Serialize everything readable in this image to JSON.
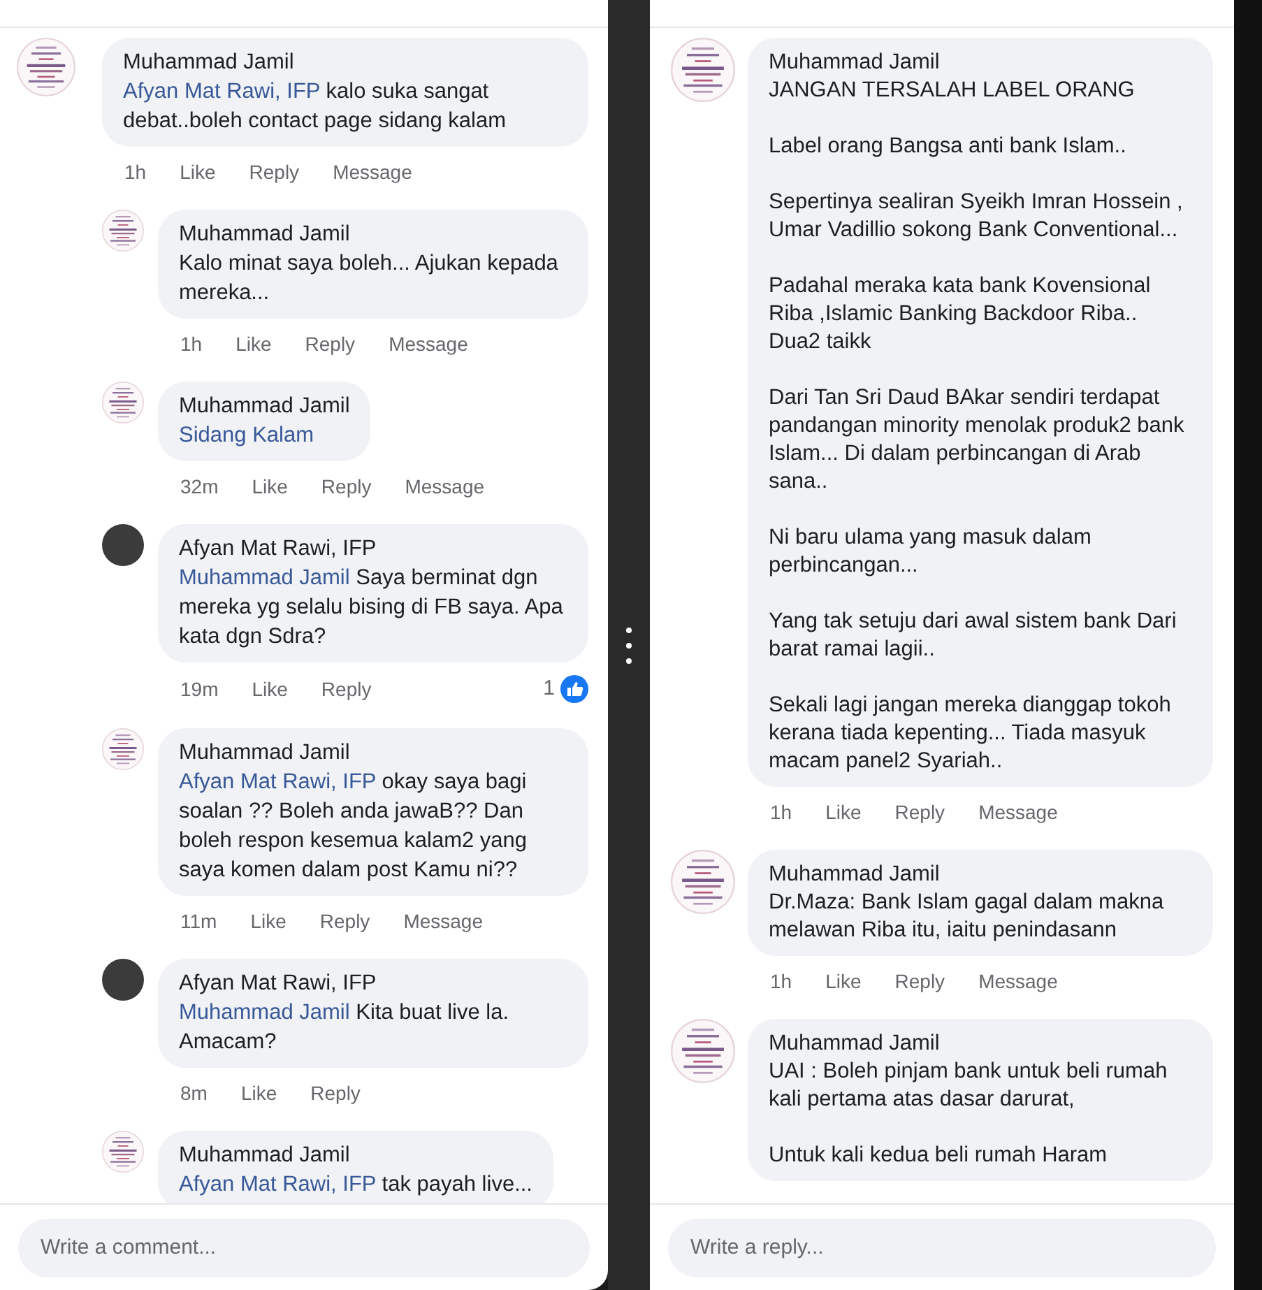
{
  "panels": [
    {
      "comments": [
        {
          "kind": "top",
          "avatar": {
            "kind": "logo"
          },
          "author": "Muhammad Jamil",
          "mention": "Afyan Mat Rawi, IFP",
          "text": "kalo suka sangat debat..boleh contact page sidang kalam",
          "time": "1h",
          "actions": [
            "Like",
            "Reply",
            "Message"
          ]
        },
        {
          "kind": "reply",
          "avatar": {
            "kind": "logo"
          },
          "author": "Muhammad Jamil",
          "text": "Kalo minat saya boleh... Ajukan kepada mereka...",
          "time": "1h",
          "actions": [
            "Like",
            "Reply",
            "Message"
          ]
        },
        {
          "kind": "reply",
          "avatar": {
            "kind": "logo"
          },
          "author": "Muhammad Jamil",
          "mention": "Sidang Kalam",
          "time": "32m",
          "actions": [
            "Like",
            "Reply",
            "Message"
          ]
        },
        {
          "kind": "reply",
          "avatar": {
            "kind": "photo"
          },
          "author": "Afyan Mat Rawi, IFP",
          "mention": "Muhammad Jamil",
          "text": "Saya berminat dgn mereka yg selalu bising di FB saya. Apa kata dgn Sdra?",
          "time": "19m",
          "actions": [
            "Like",
            "Reply"
          ],
          "reactions": "1"
        },
        {
          "kind": "reply",
          "avatar": {
            "kind": "logo"
          },
          "author": "Muhammad Jamil",
          "mention": "Afyan Mat Rawi, IFP",
          "text": "okay saya bagi soalan ?? Boleh anda jawaB?? Dan boleh respon kesemua kalam2 yang saya komen dalam post Kamu ni??",
          "time": "11m",
          "actions": [
            "Like",
            "Reply",
            "Message"
          ]
        },
        {
          "kind": "reply",
          "avatar": {
            "kind": "photo"
          },
          "author": "Afyan Mat Rawi, IFP",
          "mention": "Muhammad Jamil",
          "text": "Kita buat live la. Amacam?",
          "time": "8m",
          "actions": [
            "Like",
            "Reply"
          ]
        },
        {
          "kind": "reply",
          "avatar": {
            "kind": "logo"
          },
          "author": "Muhammad Jamil",
          "mention": "Afyan Mat Rawi, IFP",
          "text": "tak payah live..."
        }
      ],
      "composer": {
        "placeholder": "Write a comment..."
      }
    },
    {
      "comments": [
        {
          "kind": "wide",
          "avatar": {
            "kind": "logo"
          },
          "author": "Muhammad Jamil",
          "text": "JANGAN TERSALAH LABEL ORANG\n\nLabel orang Bangsa anti bank Islam..\n\nSepertinya sealiran Syeikh Imran Hossein , Umar Vadillio sokong Bank Conventional...\n\nPadahal meraka kata bank Kovensional Riba ,Islamic Banking Backdoor Riba..\nDua2 taikk\n\nDari Tan Sri Daud BAkar sendiri terdapat pandangan minority menolak produk2 bank Islam... Di dalam perbincangan di Arab sana..\n\nNi baru ulama yang masuk dalam perbincangan...\n\nYang tak setuju dari awal sistem bank Dari barat ramai lagii..\n\nSekali lagi jangan mereka dianggap tokoh kerana tiada kepenting... Tiada masyuk macam panel2 Syariah..",
          "time": "1h",
          "actions": [
            "Like",
            "Reply",
            "Message"
          ]
        },
        {
          "kind": "wide",
          "avatar": {
            "kind": "logo"
          },
          "author": "Muhammad Jamil",
          "text": "Dr.Maza: Bank Islam gagal dalam makna melawan Riba itu, iaitu penindasann",
          "time": "1h",
          "actions": [
            "Like",
            "Reply",
            "Message"
          ]
        },
        {
          "kind": "wide",
          "avatar": {
            "kind": "logo"
          },
          "author": "Muhammad Jamil",
          "text": "UAI : Boleh pinjam bank untuk beli rumah kali pertama atas dasar darurat,\n\nUntuk kali kedua beli rumah Haram"
        }
      ],
      "composer": {
        "placeholder": "Write a reply..."
      }
    }
  ]
}
